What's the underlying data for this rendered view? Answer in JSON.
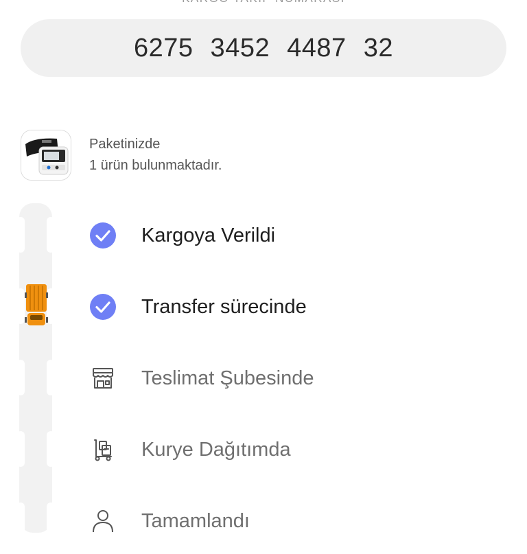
{
  "tracking": {
    "caption": "KARGO TAKİP NUMARASI",
    "number": "6275  3452  4487  32"
  },
  "package": {
    "line1": "Paketinizde",
    "line2": "1 ürün bulunmaktadır."
  },
  "steps": [
    {
      "label": "Kargoya Verildi",
      "status": "done",
      "icon": "check-circle-icon"
    },
    {
      "label": "Transfer sürecinde",
      "status": "done",
      "icon": "check-circle-icon"
    },
    {
      "label": "Teslimat Şubesinde",
      "status": "pending",
      "icon": "store-icon"
    },
    {
      "label": "Kurye Dağıtımda",
      "status": "pending",
      "icon": "courier-icon"
    },
    {
      "label": "Tamamlandı",
      "status": "pending",
      "icon": "user-icon"
    }
  ],
  "colors": {
    "accent": "#6f7ff5",
    "truck": "#f0900f",
    "road": "#f2f2f2",
    "pill": "#f0f0f0"
  }
}
